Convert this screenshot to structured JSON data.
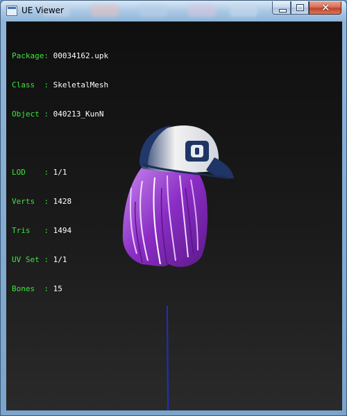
{
  "window": {
    "title": "UE Viewer",
    "app_icon": "window-app-icon",
    "buttons": {
      "minimize": "minimize-icon",
      "maximize": "maximize-icon",
      "close_glyph": "✕"
    }
  },
  "info": {
    "object_info": [
      {
        "label": "Package: ",
        "value": "00034162.upk"
      },
      {
        "label": "Class  : ",
        "value": "SkeletalMesh"
      },
      {
        "label": "Object : ",
        "value": "040213_KunN"
      }
    ],
    "mesh_stats": [
      {
        "label": "LOD    : ",
        "value": "1/1"
      },
      {
        "label": "Verts  : ",
        "value": "1428"
      },
      {
        "label": "Tris   : ",
        "value": "1494"
      },
      {
        "label": "UV Set : ",
        "value": "1/1"
      },
      {
        "label": "Bones  : ",
        "value": "15"
      }
    ]
  },
  "colors": {
    "label_green": "#3ce63c",
    "value_white": "#ffffff",
    "cap_blue": "#2b4c80",
    "hair_purple": "#a64dd6",
    "axis_blue": "#1c2fd0"
  }
}
